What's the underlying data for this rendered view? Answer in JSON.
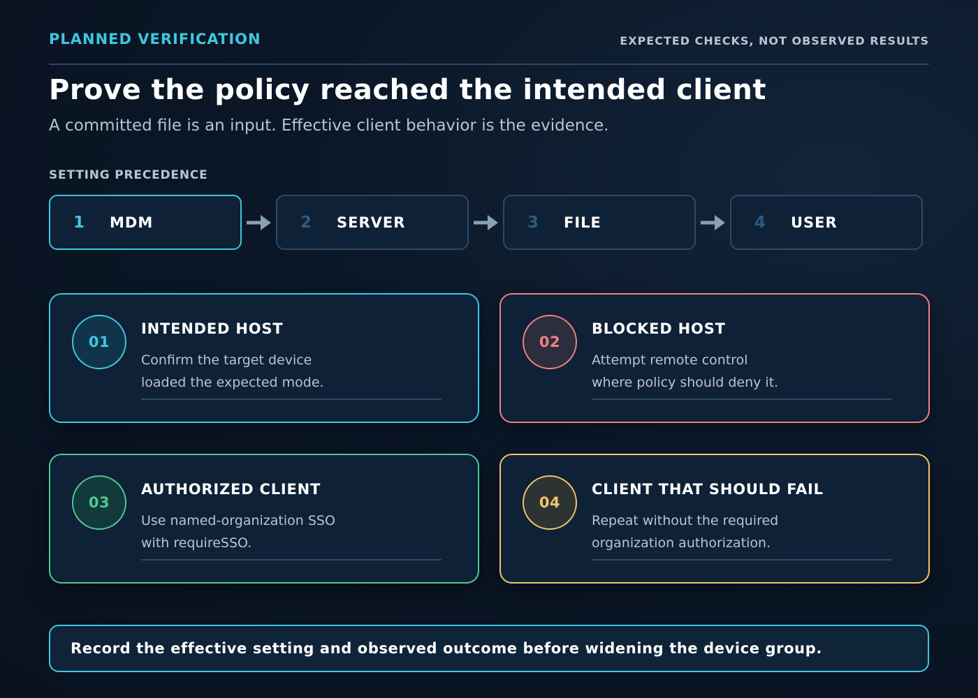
{
  "header": {
    "eyebrow": "PLANNED VERIFICATION",
    "note": "EXPECTED CHECKS, NOT OBSERVED RESULTS",
    "title": "Prove the policy reached the intended client",
    "subtitle": "A committed file is an input. Effective client behavior is the evidence."
  },
  "precedence": {
    "label": "SETTING PRECEDENCE",
    "steps": [
      {
        "num": "1",
        "label": "MDM"
      },
      {
        "num": "2",
        "label": "SERVER"
      },
      {
        "num": "3",
        "label": "FILE"
      },
      {
        "num": "4",
        "label": "USER"
      }
    ]
  },
  "checks": [
    {
      "num": "01",
      "title": "INTENDED HOST",
      "line1": "Confirm the target device",
      "line2": "loaded the expected mode."
    },
    {
      "num": "02",
      "title": "BLOCKED HOST",
      "line1": "Attempt remote control",
      "line2": "where policy should deny it."
    },
    {
      "num": "03",
      "title": "AUTHORIZED CLIENT",
      "line1": "Use named-organization SSO",
      "line2": "with requireSSO."
    },
    {
      "num": "04",
      "title": "CLIENT THAT SHOULD FAIL",
      "line1": "Repeat without the required",
      "line2": "organization authorization."
    }
  ],
  "colors": {
    "cyan": "#3ec7e0",
    "red": "#f08080",
    "green": "#4ec994",
    "amber": "#f3c46a",
    "arrow": "#8aa0b5"
  },
  "footer": {
    "text": "Record the effective setting and observed outcome before widening the device group."
  }
}
